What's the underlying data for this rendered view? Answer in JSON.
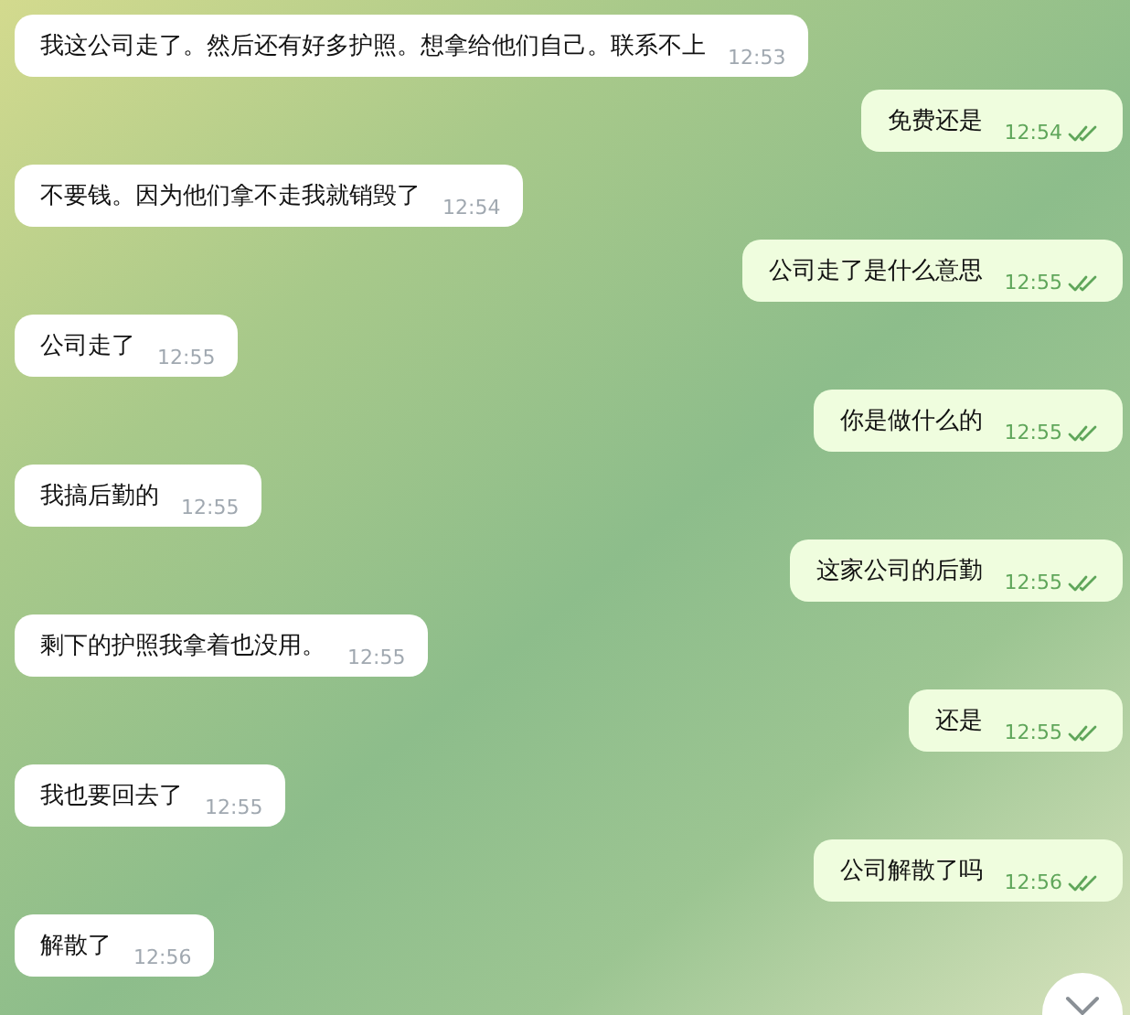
{
  "messages": [
    {
      "kind": "in",
      "text": "我这公司走了。然后还有好多护照。想拿给他们自己。联系不上",
      "time": "12:53"
    },
    {
      "kind": "out",
      "text": "免费还是",
      "time": "12:54",
      "read": true
    },
    {
      "kind": "in",
      "text": "不要钱。因为他们拿不走我就销毁了",
      "time": "12:54"
    },
    {
      "kind": "out",
      "text": "公司走了是什么意思",
      "time": "12:55",
      "read": true
    },
    {
      "kind": "in",
      "text": "公司走了",
      "time": "12:55"
    },
    {
      "kind": "out",
      "text": "你是做什么的",
      "time": "12:55",
      "read": true
    },
    {
      "kind": "in",
      "text": "我搞后勤的",
      "time": "12:55"
    },
    {
      "kind": "out",
      "text": "这家公司的后勤",
      "time": "12:55",
      "read": true
    },
    {
      "kind": "in",
      "text": "剩下的护照我拿着也没用。",
      "time": "12:55"
    },
    {
      "kind": "out",
      "text": "还是",
      "time": "12:55",
      "read": true
    },
    {
      "kind": "in",
      "text": "我也要回去了",
      "time": "12:55"
    },
    {
      "kind": "out",
      "text": "公司解散了吗",
      "time": "12:56",
      "read": true
    },
    {
      "kind": "in",
      "text": "解散了",
      "time": "12:56"
    }
  ]
}
